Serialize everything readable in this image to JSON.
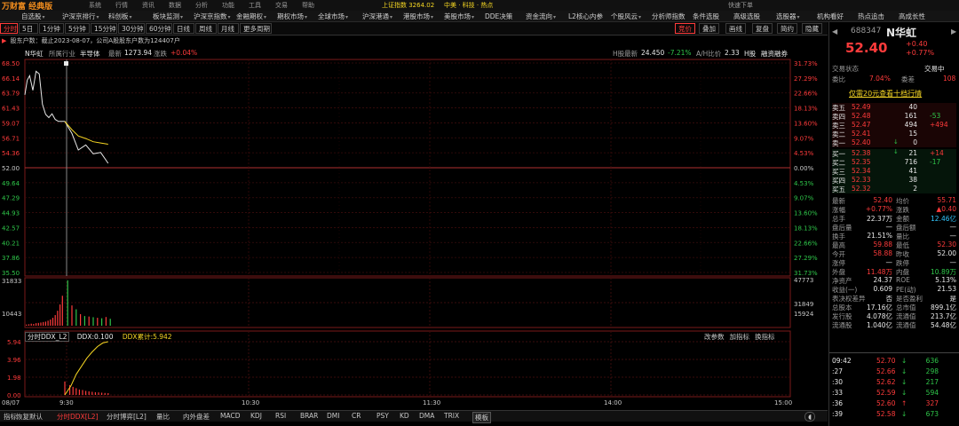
{
  "top_header": {
    "brand": "万财富 经典版",
    "menu": [
      "系统",
      "行情",
      "资讯",
      "数据",
      "分析",
      "功能",
      "工具",
      "交易",
      "帮助"
    ],
    "ticker": "上证指数 3264.02",
    "news": "中美 · 科技 · 热点",
    "right_btn": "快速下单"
  },
  "nav": {
    "items": [
      {
        "label": "自选股",
        "caret": true
      },
      {
        "label": "沪深京排行",
        "caret": true
      },
      {
        "label": "科创板",
        "caret": true
      },
      {
        "label": "板块监测",
        "caret": true
      },
      {
        "label": "沪深京指数",
        "caret": true
      },
      {
        "label": "金融期权",
        "caret": true
      },
      {
        "label": "期权市场",
        "caret": true
      },
      {
        "label": "全球市场",
        "caret": true
      },
      {
        "label": "沪深港通",
        "caret": true
      },
      {
        "label": "港股市场",
        "caret": true
      },
      {
        "label": "美股市场",
        "caret": true
      },
      {
        "label": "DDE决策",
        "caret": false
      },
      {
        "label": "资金流向",
        "caret": true
      },
      {
        "label": "L2核心内参",
        "caret": false
      },
      {
        "label": "个股风云",
        "caret": true
      },
      {
        "label": "分析师指数",
        "caret": false
      },
      {
        "label": "条件选股",
        "caret": false
      },
      {
        "label": "高级选股",
        "caret": false
      },
      {
        "label": "选股器",
        "caret": true
      },
      {
        "label": "机构看好",
        "caret": false
      },
      {
        "label": "热点追击",
        "caret": false
      },
      {
        "label": "高成长性",
        "caret": false
      }
    ]
  },
  "periods": [
    "分时",
    "5日",
    "1分钟",
    "5分钟",
    "15分钟",
    "30分钟",
    "60分钟",
    "日线",
    "周线",
    "月线",
    "更多周期"
  ],
  "active_period": "分时",
  "right_buttons": {
    "fuquan": "竞价",
    "items": [
      "叠加",
      "画线",
      "复盘",
      "简约",
      "隐藏"
    ],
    "more": "多"
  },
  "notice": "股东户数：截止2023-08-07，公司A股股东户数为124407户",
  "info": {
    "name": "N华虹",
    "industry_label": "所属行业",
    "industry": "半导体",
    "latest_label": "最新",
    "latest": "1273.94",
    "change_label": "涨跌",
    "change": "+0.04%",
    "h_label": "H股最新",
    "h_price": "24.450",
    "h_pct": "-7.21%",
    "ah_label": "A/H比价",
    "ah": "2.33",
    "hstock": "H股",
    "margin": "融资融券"
  },
  "chart_data": [
    {
      "type": "line",
      "title": "分时",
      "xlabel": "",
      "ylabel": "",
      "x_ticks": [
        "08/07",
        "9:30",
        "10:30",
        "11:30",
        "14:00",
        "15:00"
      ],
      "y_ticks_left": [
        "68.50",
        "66.14",
        "63.79",
        "61.43",
        "59.07",
        "56.71",
        "54.36",
        "52.00",
        "49.64",
        "47.29",
        "44.93",
        "42.57",
        "40.21",
        "37.86",
        "35.50"
      ],
      "y_ticks_right": [
        "31.73%",
        "27.29%",
        "22.66%",
        "18.13%",
        "13.60%",
        "9.07%",
        "4.53%",
        "0.00%",
        "4.53%",
        "9.07%",
        "13.60%",
        "18.13%",
        "22.66%",
        "27.29%",
        "31.73%"
      ],
      "ylim": [
        35.5,
        68.5
      ],
      "prev_close": 52.0,
      "series": [
        {
          "name": "price",
          "color": "#e8e8e8",
          "x": [
            "08/07",
            "08/07",
            "08/07",
            "08/07",
            "08/07",
            "08/07",
            "08/07",
            "08/07",
            "08/07",
            "08/07",
            "08/07",
            "08/07",
            "09:30",
            "09:32",
            "09:34",
            "09:36",
            "09:38",
            "09:40",
            "09:42"
          ],
          "xi": [
            0,
            0.3,
            0.6,
            1.0,
            1.4,
            1.8,
            2.2,
            2.6,
            3.0,
            3.4,
            3.8,
            4.2,
            5,
            5.5,
            6.1,
            6.8,
            7.5,
            8.2,
            8.9
          ],
          "values": [
            63.5,
            65.8,
            66.5,
            64.2,
            67.2,
            66.8,
            62.0,
            60.4,
            59.9,
            60.5,
            59.6,
            59.3,
            59.3,
            57.4,
            54.8,
            55.6,
            54.2,
            54.4,
            52.7
          ]
        },
        {
          "name": "avg",
          "color": "#f5d623",
          "xi": [
            5,
            5.5,
            6.1,
            6.8,
            7.5,
            8.2,
            8.9
          ],
          "values": [
            59.3,
            58.0,
            57.0,
            56.6,
            56.1,
            55.9,
            55.7
          ]
        }
      ]
    },
    {
      "type": "bar",
      "title": "成交量",
      "y_ticks_left": [
        "31833",
        "10443"
      ],
      "y_ticks_right": [
        "47773",
        "31849",
        "15924"
      ],
      "ylim": [
        0,
        47773
      ],
      "bars": [
        {
          "xi": 0.2,
          "v": 1200,
          "c": "r"
        },
        {
          "xi": 0.5,
          "v": 1500,
          "c": "r"
        },
        {
          "xi": 0.8,
          "v": 2100,
          "c": "r"
        },
        {
          "xi": 1.1,
          "v": 1800,
          "c": "r"
        },
        {
          "xi": 1.4,
          "v": 2600,
          "c": "r"
        },
        {
          "xi": 1.7,
          "v": 2900,
          "c": "r"
        },
        {
          "xi": 2.0,
          "v": 3300,
          "c": "r"
        },
        {
          "xi": 2.3,
          "v": 3800,
          "c": "r"
        },
        {
          "xi": 2.6,
          "v": 4200,
          "c": "r"
        },
        {
          "xi": 2.9,
          "v": 5200,
          "c": "r"
        },
        {
          "xi": 3.2,
          "v": 6400,
          "c": "r"
        },
        {
          "xi": 3.5,
          "v": 8200,
          "c": "r"
        },
        {
          "xi": 3.8,
          "v": 11000,
          "c": "r"
        },
        {
          "xi": 4.1,
          "v": 15500,
          "c": "r"
        },
        {
          "xi": 4.4,
          "v": 22000,
          "c": "r"
        },
        {
          "xi": 4.7,
          "v": 31000,
          "c": "r"
        },
        {
          "xi": 5.1,
          "v": 47000,
          "c": "g"
        },
        {
          "xi": 5.5,
          "v": 21000,
          "c": "r"
        },
        {
          "xi": 5.9,
          "v": 17000,
          "c": "g"
        },
        {
          "xi": 6.3,
          "v": 12000,
          "c": "r"
        },
        {
          "xi": 6.7,
          "v": 10000,
          "c": "g"
        },
        {
          "xi": 7.1,
          "v": 9500,
          "c": "r"
        },
        {
          "xi": 7.5,
          "v": 8800,
          "c": "g"
        },
        {
          "xi": 7.9,
          "v": 8200,
          "c": "r"
        },
        {
          "xi": 8.3,
          "v": 7700,
          "c": "g"
        },
        {
          "xi": 8.7,
          "v": 9000,
          "c": "r"
        },
        {
          "xi": 9.1,
          "v": 7200,
          "c": "g"
        }
      ]
    },
    {
      "type": "line",
      "title": "DDX",
      "y_ticks_left": [
        "5.94",
        "3.96",
        "1.98",
        "0.00"
      ],
      "ylim": [
        0,
        5.94
      ],
      "series": [
        {
          "name": "DDX累计",
          "color": "#f5d623",
          "xi": [
            5,
            5.4,
            5.9,
            6.4,
            6.9,
            7.4,
            7.9,
            8.4,
            8.9
          ],
          "values": [
            0.0,
            1.0,
            2.3,
            3.2,
            4.1,
            4.8,
            5.4,
            5.8,
            5.94
          ]
        }
      ],
      "bars": [
        {
          "xi": 5.0,
          "v": 1.5
        },
        {
          "xi": 5.3,
          "v": 1.1
        },
        {
          "xi": 5.6,
          "v": 0.9
        },
        {
          "xi": 5.9,
          "v": 0.75
        },
        {
          "xi": 6.2,
          "v": 0.6
        },
        {
          "xi": 6.5,
          "v": 0.55
        },
        {
          "xi": 6.8,
          "v": 0.45
        },
        {
          "xi": 7.1,
          "v": 0.4
        },
        {
          "xi": 7.4,
          "v": 0.35
        },
        {
          "xi": 7.7,
          "v": 0.3
        },
        {
          "xi": 8.0,
          "v": 0.28
        },
        {
          "xi": 8.3,
          "v": 0.25
        },
        {
          "xi": 8.6,
          "v": 0.22
        },
        {
          "xi": 8.9,
          "v": 0.2
        }
      ]
    }
  ],
  "ddx": {
    "tab": "分时DDX_L2",
    "val_label": "DDX:",
    "val": "0.100",
    "cum_label": "DDX累计:",
    "cum": "5.942",
    "tools": [
      "改参数",
      "加指标",
      "换指标"
    ]
  },
  "bottom_tabs": [
    "指标",
    "恢复默认",
    "分时DDX[L2]",
    "分时博弈[L2]",
    "量比",
    "内外盘差",
    "MACD",
    "KDJ",
    "RSI",
    "BRAR",
    "DMI",
    "CR",
    "PSY",
    "KD",
    "DMA",
    "TRIX",
    "模板"
  ],
  "active_bottom_tab": "分时DDX[L2]",
  "right_panel": {
    "code": "688347",
    "name": "N华虹",
    "price": "52.40",
    "chg": "+0.40",
    "pct": "+0.77%",
    "status_label": "交易状态",
    "status_value": "交易中",
    "weibi_label": "委比",
    "weibi": "7.04%",
    "weicha_label": "委差",
    "weicha": "108",
    "offer_link": "仅需20元查看十档行情",
    "asks": [
      {
        "label": "卖五",
        "price": "52.49",
        "vol": "40",
        "chg": ""
      },
      {
        "label": "卖四",
        "price": "52.48",
        "vol": "161",
        "chg": "-53"
      },
      {
        "label": "卖三",
        "price": "52.47",
        "vol": "494",
        "chg": "+494"
      },
      {
        "label": "卖二",
        "price": "52.41",
        "vol": "15",
        "chg": ""
      },
      {
        "label": "卖一",
        "price": "52.40",
        "vol": "0",
        "chg": ""
      }
    ],
    "bids": [
      {
        "label": "买一",
        "price": "52.38",
        "vol": "21",
        "chg": "+14"
      },
      {
        "label": "买二",
        "price": "52.35",
        "vol": "716",
        "chg": "-17"
      },
      {
        "label": "买三",
        "price": "52.34",
        "vol": "41",
        "chg": ""
      },
      {
        "label": "买四",
        "price": "52.33",
        "vol": "38",
        "chg": ""
      },
      {
        "label": "买五",
        "price": "52.32",
        "vol": "2",
        "chg": ""
      }
    ],
    "stats": [
      {
        "l1": "最新",
        "v1": "52.40",
        "c1": "red",
        "l2": "均价",
        "v2": "55.71",
        "c2": "red"
      },
      {
        "l1": "涨幅",
        "v1": "+0.77%",
        "c1": "red",
        "l2": "涨跌",
        "v2": "▲0.40",
        "c2": "red"
      },
      {
        "l1": "总手",
        "v1": "22.37万",
        "c1": "white",
        "l2": "金额",
        "v2": "12.46亿",
        "c2": "cyan"
      },
      {
        "l1": "盘后量",
        "v1": "—",
        "c1": "white",
        "l2": "盘后额",
        "v2": "—",
        "c2": "white"
      },
      {
        "l1": "换手",
        "v1": "21.51%",
        "c1": "white",
        "l2": "量比",
        "v2": "—",
        "c2": "white"
      },
      {
        "l1": "最高",
        "v1": "59.88",
        "c1": "red",
        "l2": "最低",
        "v2": "52.30",
        "c2": "red"
      },
      {
        "l1": "今开",
        "v1": "58.88",
        "c1": "red",
        "l2": "昨收",
        "v2": "52.00",
        "c2": "white"
      },
      {
        "l1": "涨停",
        "v1": "—",
        "c1": "white",
        "l2": "跌停",
        "v2": "—",
        "c2": "white"
      },
      {
        "l1": "外盘",
        "v1": "11.48万",
        "c1": "red",
        "l2": "内盘",
        "v2": "10.89万",
        "c2": "green"
      },
      {
        "l1": "净资产",
        "v1": "24.37",
        "c1": "white",
        "l2": "ROE",
        "v2": "5.13%",
        "c2": "white"
      },
      {
        "l1": "收益(一)",
        "v1": "0.609",
        "c1": "white",
        "l2": "PE(动)",
        "v2": "21.53",
        "c2": "white"
      },
      {
        "l1": "表决权差异",
        "v1": "否",
        "c1": "white",
        "l2": "是否盈利",
        "v2": "是",
        "c2": "white"
      },
      {
        "l1": "总股本",
        "v1": "17.16亿",
        "c1": "white",
        "l2": "总市值",
        "v2": "899.1亿",
        "c2": "white"
      },
      {
        "l1": "发行股",
        "v1": "4.078亿",
        "c1": "white",
        "l2": "流通值",
        "v2": "213.7亿",
        "c2": "white"
      },
      {
        "l1": "流通股",
        "v1": "1.040亿",
        "c1": "white",
        "l2": "流通值",
        "v2": "54.48亿",
        "c2": "white"
      }
    ],
    "ticks": [
      {
        "t": "09:42",
        "p": "52.70",
        "a": "↓",
        "v": "636",
        "vc": "green"
      },
      {
        "t": ":27",
        "p": "52.66",
        "a": "↓",
        "v": "298",
        "vc": "green"
      },
      {
        "t": ":30",
        "p": "52.62",
        "a": "↓",
        "v": "217",
        "vc": "green"
      },
      {
        "t": ":33",
        "p": "52.59",
        "a": "↓",
        "v": "594",
        "vc": "green"
      },
      {
        "t": ":36",
        "p": "52.60",
        "a": "↑",
        "v": "327",
        "vc": "red"
      },
      {
        "t": ":39",
        "p": "52.58",
        "a": "↓",
        "v": "673",
        "vc": "green"
      }
    ]
  },
  "colors": {
    "up": "#ff3b3b",
    "down": "#2fc74a",
    "avg": "#f5d623",
    "grid": "#5a1010",
    "axis": "#7a1a1a"
  }
}
